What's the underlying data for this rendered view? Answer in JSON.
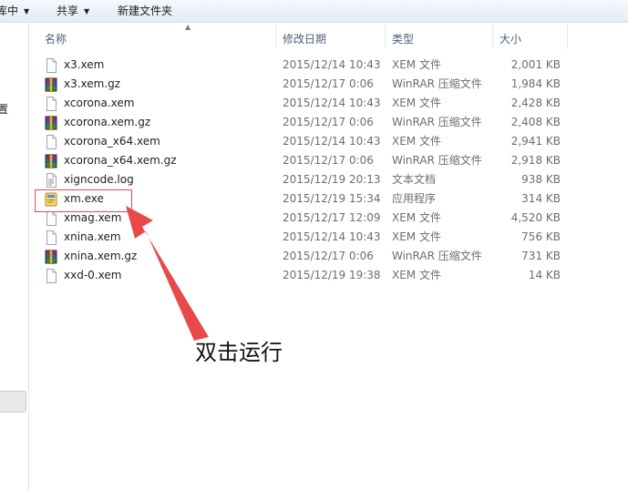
{
  "toolbar": {
    "organize_fragment": "库中",
    "share_label": "共享",
    "new_folder_label": "新建文件夹"
  },
  "left_pane": {
    "text_fragment": "置"
  },
  "columns": {
    "name": "名称",
    "modified": "修改日期",
    "type": "类型",
    "size": "大小"
  },
  "files": [
    {
      "name": "x3.xem",
      "modified": "2015/12/14 10:43",
      "type": "XEM 文件",
      "size": "2,001 KB",
      "icon": "file-icon"
    },
    {
      "name": "x3.xem.gz",
      "modified": "2015/12/17 0:06",
      "type": "WinRAR 压缩文件",
      "size": "1,984 KB",
      "icon": "winrar-archive-icon"
    },
    {
      "name": "xcorona.xem",
      "modified": "2015/12/14 10:43",
      "type": "XEM 文件",
      "size": "2,428 KB",
      "icon": "file-icon"
    },
    {
      "name": "xcorona.xem.gz",
      "modified": "2015/12/17 0:06",
      "type": "WinRAR 压缩文件",
      "size": "2,408 KB",
      "icon": "winrar-archive-icon"
    },
    {
      "name": "xcorona_x64.xem",
      "modified": "2015/12/14 10:43",
      "type": "XEM 文件",
      "size": "2,941 KB",
      "icon": "file-icon"
    },
    {
      "name": "xcorona_x64.xem.gz",
      "modified": "2015/12/17 0:06",
      "type": "WinRAR 压缩文件",
      "size": "2,918 KB",
      "icon": "winrar-archive-icon"
    },
    {
      "name": "xigncode.log",
      "modified": "2015/12/19 20:13",
      "type": "文本文档",
      "size": "938 KB",
      "icon": "text-document-icon"
    },
    {
      "name": "xm.exe",
      "modified": "2015/12/19 15:34",
      "type": "应用程序",
      "size": "314 KB",
      "icon": "application-icon"
    },
    {
      "name": "xmag.xem",
      "modified": "2015/12/17 12:09",
      "type": "XEM 文件",
      "size": "4,520 KB",
      "icon": "file-icon"
    },
    {
      "name": "xnina.xem",
      "modified": "2015/12/14 10:43",
      "type": "XEM 文件",
      "size": "756 KB",
      "icon": "file-icon"
    },
    {
      "name": "xnina.xem.gz",
      "modified": "2015/12/17 0:06",
      "type": "WinRAR 压缩文件",
      "size": "731 KB",
      "icon": "winrar-archive-icon"
    },
    {
      "name": "xxd-0.xem",
      "modified": "2015/12/19 19:38",
      "type": "XEM 文件",
      "size": "14 KB",
      "icon": "file-icon"
    }
  ],
  "annotation": {
    "label": "双击运行",
    "color": "#e84a4a"
  }
}
